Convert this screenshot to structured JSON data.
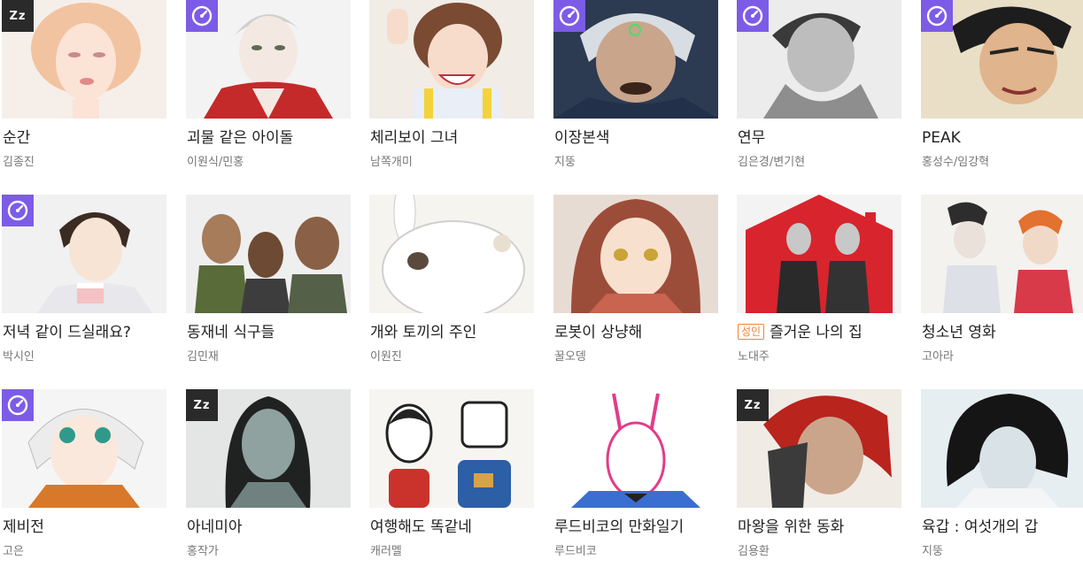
{
  "badges": {
    "dormant_text": "Zz"
  },
  "colors": {
    "speed_badge": "#7c5ce6",
    "dormant_badge": "#2a2a2a",
    "adult_tag": "#f0853a"
  },
  "rows": [
    [
      {
        "title": "순간",
        "author": "김종진",
        "badge": "dormant",
        "adult": false,
        "icon": "sleep-icon"
      },
      {
        "title": "괴물 같은 아이돌",
        "author": "이원식/민홍",
        "badge": "speed",
        "adult": false,
        "icon": "speedometer-icon"
      },
      {
        "title": "체리보이 그녀",
        "author": "남쪽개미",
        "badge": "none",
        "adult": false
      },
      {
        "title": "이장본색",
        "author": "지뚱",
        "badge": "speed",
        "adult": false,
        "icon": "speedometer-icon"
      },
      {
        "title": "연무",
        "author": "김은경/변기현",
        "badge": "speed",
        "adult": false,
        "icon": "speedometer-icon"
      },
      {
        "title": "PEAK",
        "author": "홍성수/임강혁",
        "badge": "speed",
        "adult": false,
        "icon": "speedometer-icon"
      }
    ],
    [
      {
        "title": "저녁 같이 드실래요?",
        "author": "박시인",
        "badge": "speed",
        "adult": false,
        "icon": "speedometer-icon"
      },
      {
        "title": "동재네 식구들",
        "author": "김민재",
        "badge": "none",
        "adult": false
      },
      {
        "title": "개와 토끼의 주인",
        "author": "이원진",
        "badge": "none",
        "adult": false
      },
      {
        "title": "로봇이 상냥해",
        "author": "꿀오뎅",
        "badge": "none",
        "adult": false
      },
      {
        "title": "즐거운 나의 집",
        "author": "노대주",
        "badge": "none",
        "adult": true,
        "adult_label": "성인"
      },
      {
        "title": "청소년 영화",
        "author": "고아라",
        "badge": "none",
        "adult": false
      }
    ],
    [
      {
        "title": "제비전",
        "author": "고은",
        "badge": "speed",
        "adult": false,
        "icon": "speedometer-icon"
      },
      {
        "title": "아네미아",
        "author": "홍작가",
        "badge": "dormant",
        "adult": false,
        "icon": "sleep-icon"
      },
      {
        "title": "여행해도 똑같네",
        "author": "캐러멜",
        "badge": "none",
        "adult": false
      },
      {
        "title": "루드비코의 만화일기",
        "author": "루드비코",
        "badge": "none",
        "adult": false
      },
      {
        "title": "마왕을 위한 동화",
        "author": "김용환",
        "badge": "dormant",
        "adult": false,
        "icon": "sleep-icon"
      },
      {
        "title": "육갑 : 여섯개의 갑",
        "author": "지뚱",
        "badge": "none",
        "adult": false
      }
    ]
  ]
}
